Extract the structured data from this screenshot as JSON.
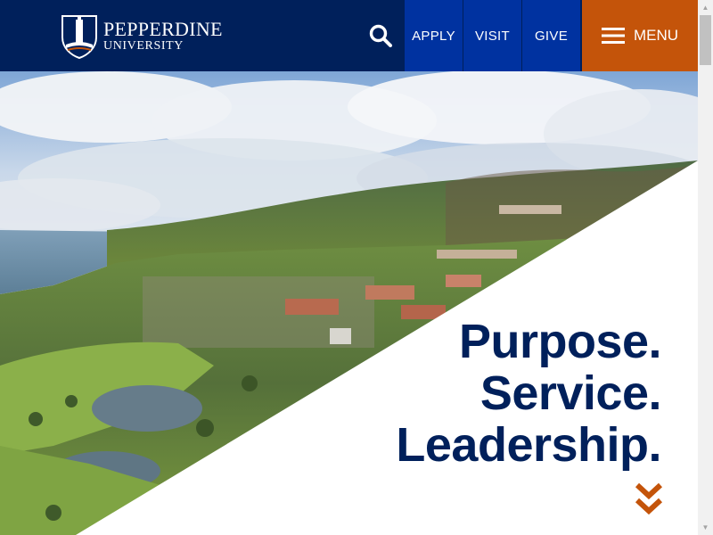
{
  "header": {
    "logo": {
      "name": "PEPPERDINE",
      "sub": "UNIVERSITY"
    },
    "search_icon": "search-icon",
    "nav": [
      {
        "label": "APPLY"
      },
      {
        "label": "VISIT"
      },
      {
        "label": "GIVE"
      }
    ],
    "menu": {
      "label": "MENU",
      "icon": "hamburger-icon"
    }
  },
  "hero": {
    "tagline": [
      "Purpose.",
      "Service.",
      "Leadership."
    ],
    "scroll_icon": "double-chevron-down-icon"
  },
  "colors": {
    "navy": "#00205b",
    "blue": "#0032a0",
    "orange": "#c4540a",
    "white": "#ffffff"
  }
}
